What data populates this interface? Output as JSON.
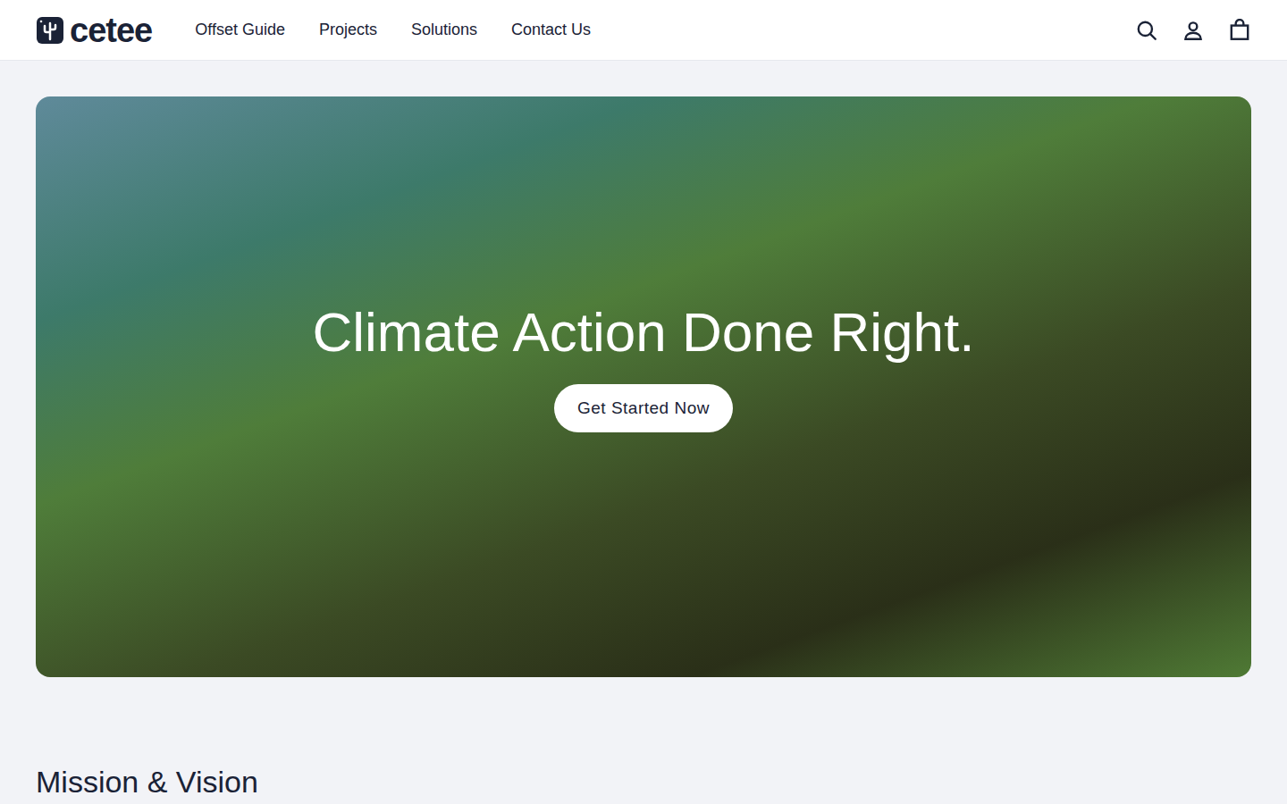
{
  "header": {
    "logo": "cetee",
    "nav": [
      "Offset Guide",
      "Projects",
      "Solutions",
      "Contact Us"
    ]
  },
  "hero": {
    "title": "Climate Action Done Right.",
    "button": "Get Started Now"
  },
  "section": {
    "title": "Mission & Vision"
  }
}
